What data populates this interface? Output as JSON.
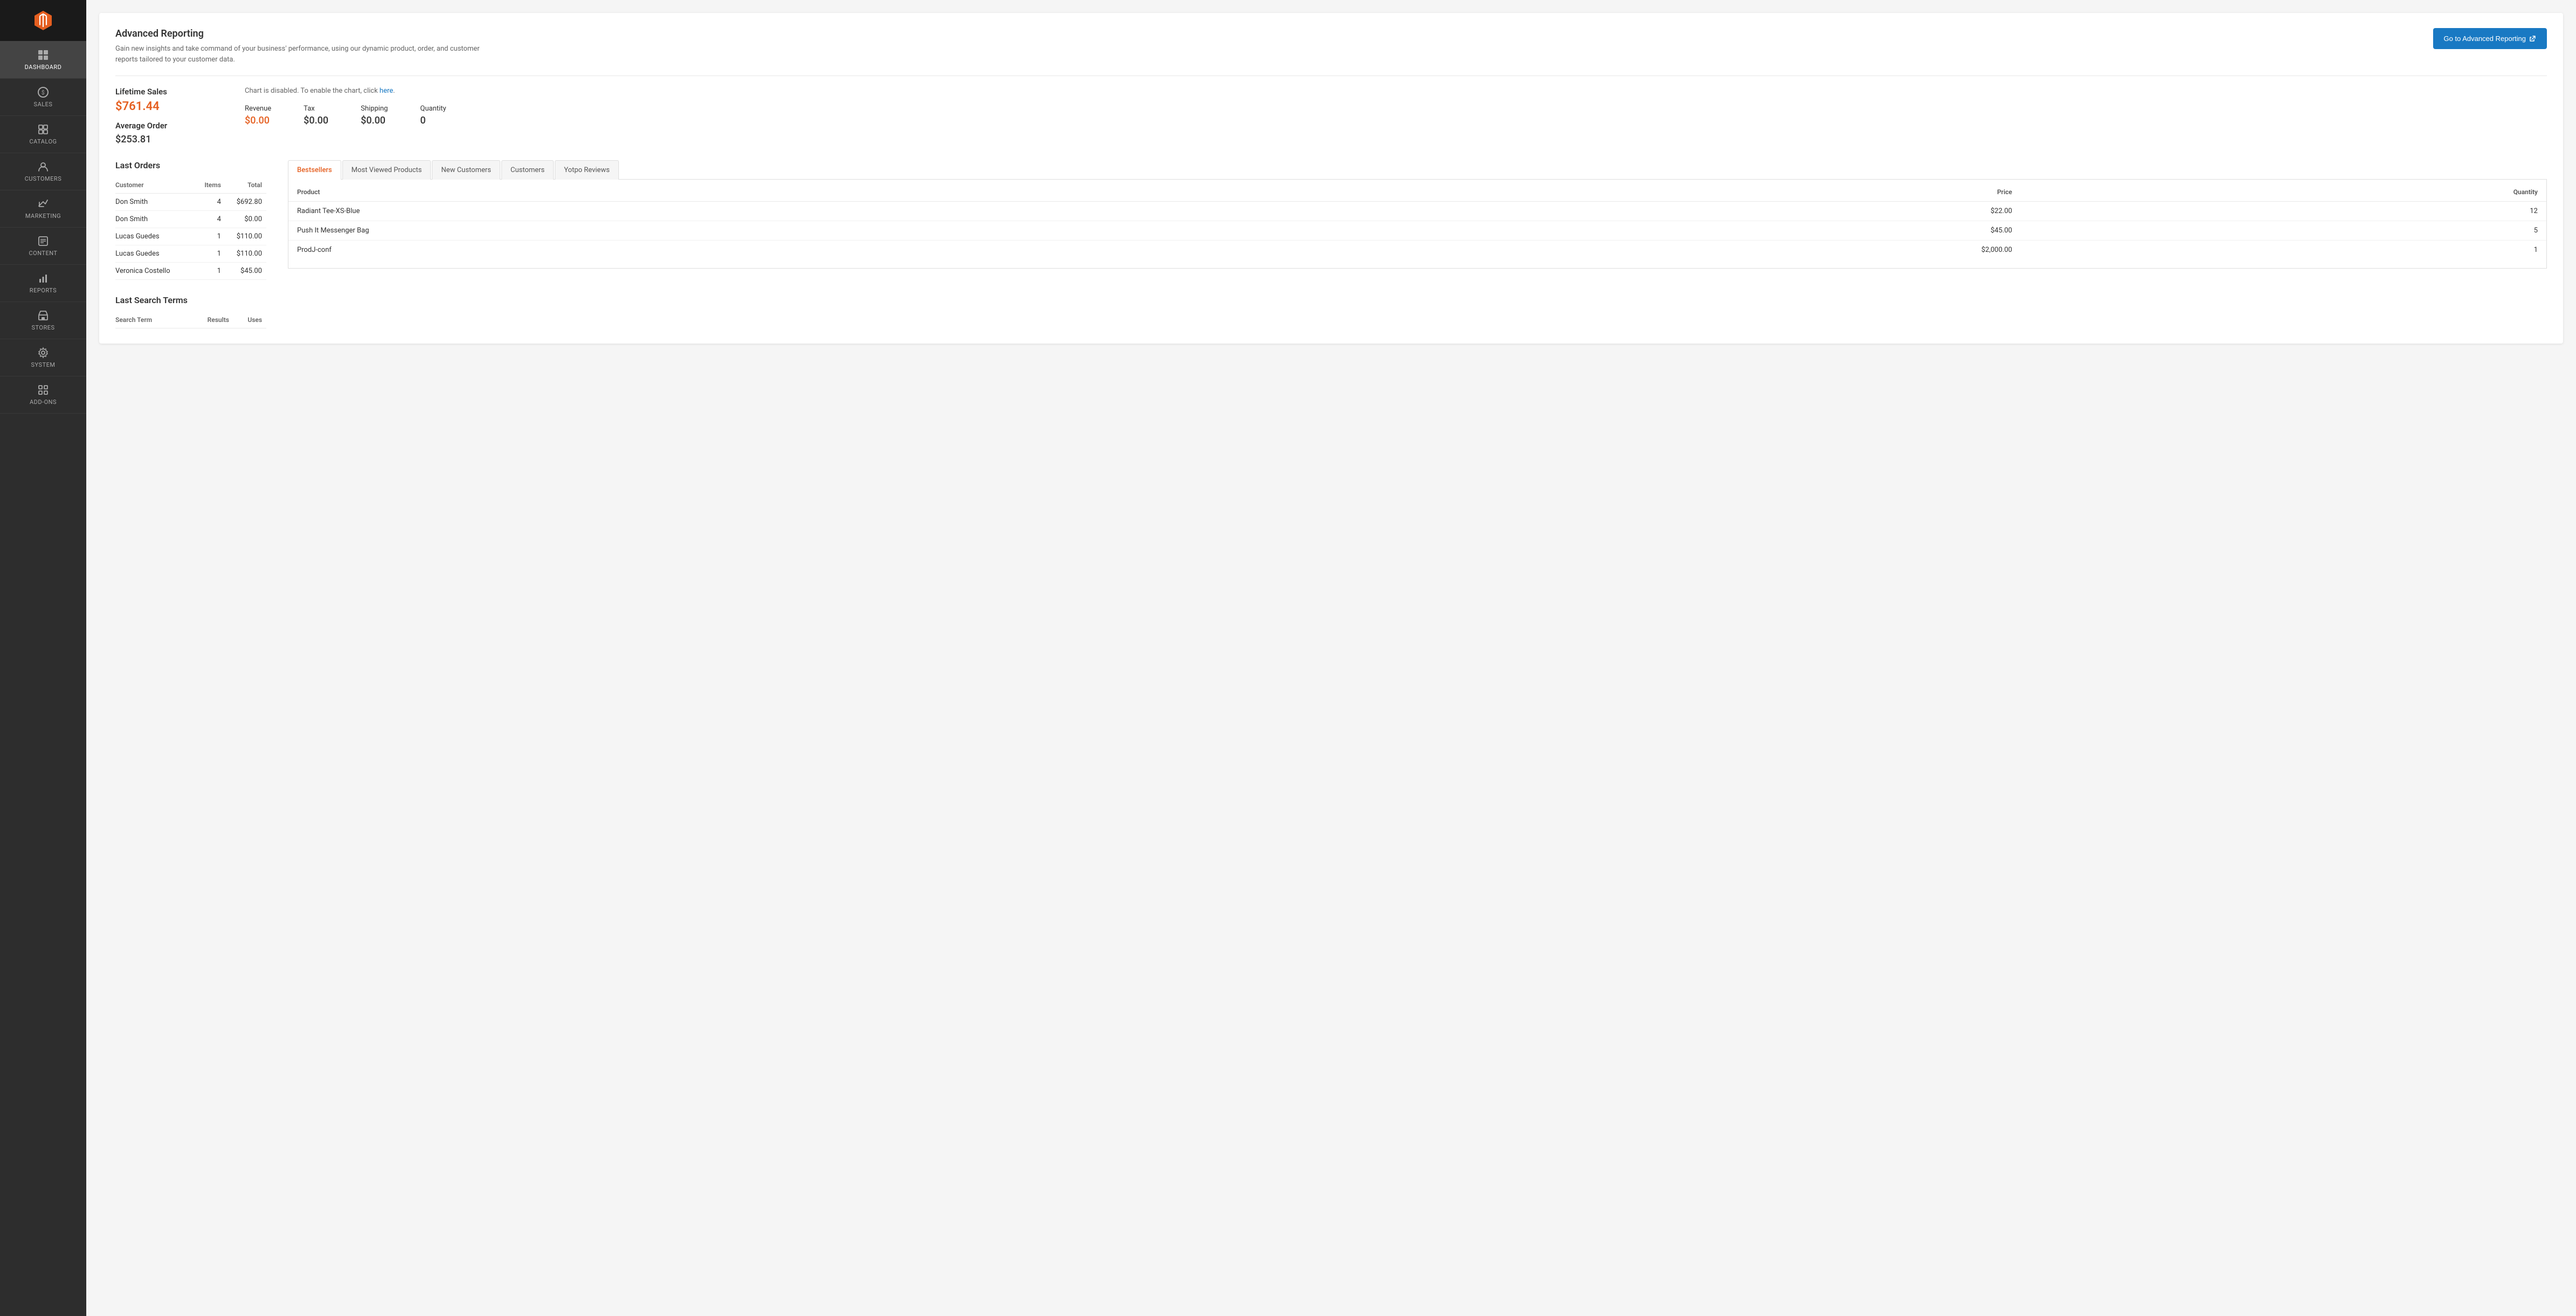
{
  "sidebar": {
    "logo_alt": "Magento Logo",
    "items": [
      {
        "id": "dashboard",
        "label": "DASHBOARD",
        "icon": "dashboard-icon",
        "active": true
      },
      {
        "id": "sales",
        "label": "SALES",
        "icon": "sales-icon",
        "active": false
      },
      {
        "id": "catalog",
        "label": "CATALOG",
        "icon": "catalog-icon",
        "active": false
      },
      {
        "id": "customers",
        "label": "CUSTOMERS",
        "icon": "customers-icon",
        "active": false
      },
      {
        "id": "marketing",
        "label": "MARKETING",
        "icon": "marketing-icon",
        "active": false
      },
      {
        "id": "content",
        "label": "CONTENT",
        "icon": "content-icon",
        "active": false
      },
      {
        "id": "reports",
        "label": "REPORTS",
        "icon": "reports-icon",
        "active": false
      },
      {
        "id": "stores",
        "label": "STORES",
        "icon": "stores-icon",
        "active": false
      },
      {
        "id": "system",
        "label": "SYSTEM",
        "icon": "system-icon",
        "active": false
      },
      {
        "id": "partners",
        "label": "ADD-ONS",
        "icon": "partners-icon",
        "active": false
      }
    ]
  },
  "advanced_reporting": {
    "title": "Advanced Reporting",
    "description": "Gain new insights and take command of your business' performance, using our dynamic product, order, and customer reports tailored to your customer data.",
    "button_label": "Go to Advanced Reporting"
  },
  "lifetime_sales": {
    "label": "Lifetime Sales",
    "value": "$761.44"
  },
  "average_order": {
    "label": "Average Order",
    "value": "$253.81"
  },
  "chart": {
    "disabled_text": "Chart is disabled. To enable the chart, click ",
    "link_text": "here",
    "link_href": "#"
  },
  "metrics": [
    {
      "label": "Revenue",
      "value": "$0.00",
      "orange": true
    },
    {
      "label": "Tax",
      "value": "$0.00",
      "orange": false
    },
    {
      "label": "Shipping",
      "value": "$0.00",
      "orange": false
    },
    {
      "label": "Quantity",
      "value": "0",
      "orange": false
    }
  ],
  "last_orders": {
    "title": "Last Orders",
    "columns": [
      "Customer",
      "Items",
      "Total"
    ],
    "rows": [
      {
        "customer": "Don Smith",
        "items": "4",
        "total": "$692.80"
      },
      {
        "customer": "Don Smith",
        "items": "4",
        "total": "$0.00"
      },
      {
        "customer": "Lucas Guedes",
        "items": "1",
        "total": "$110.00"
      },
      {
        "customer": "Lucas Guedes",
        "items": "1",
        "total": "$110.00"
      },
      {
        "customer": "Veronica Costello",
        "items": "1",
        "total": "$45.00"
      }
    ]
  },
  "tabs": [
    {
      "id": "bestsellers",
      "label": "Bestsellers",
      "active": true
    },
    {
      "id": "most-viewed",
      "label": "Most Viewed Products",
      "active": false
    },
    {
      "id": "new-customers",
      "label": "New Customers",
      "active": false
    },
    {
      "id": "customers",
      "label": "Customers",
      "active": false
    },
    {
      "id": "yotpo",
      "label": "Yotpo Reviews",
      "active": false
    }
  ],
  "bestsellers": {
    "columns": [
      "Product",
      "Price",
      "Quantity"
    ],
    "rows": [
      {
        "product": "Radiant Tee-XS-Blue",
        "price": "$22.00",
        "quantity": "12"
      },
      {
        "product": "Push It Messenger Bag",
        "price": "$45.00",
        "quantity": "5"
      },
      {
        "product": "ProdJ-conf",
        "price": "$2,000.00",
        "quantity": "1"
      }
    ]
  },
  "last_search": {
    "title": "Last Search Terms",
    "columns": [
      "Search Term",
      "Results",
      "Uses"
    ]
  },
  "colors": {
    "orange": "#e55f20",
    "blue": "#1979c3",
    "sidebar_bg": "#2d2d2d"
  }
}
